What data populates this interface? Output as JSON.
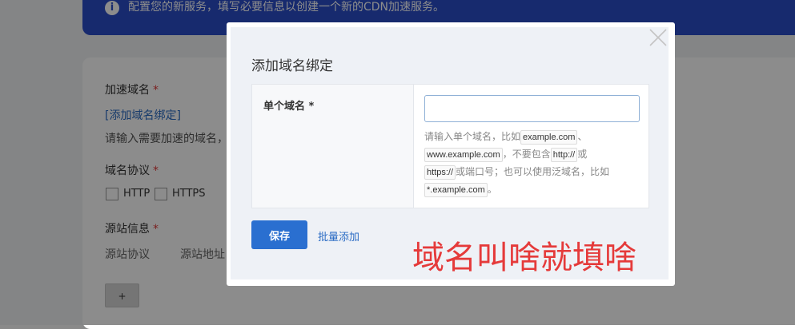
{
  "background": {
    "banner": {
      "icon": "info-icon",
      "text": "配置您的新服务，填写必要信息以创建一个新的CDN加速服务。"
    },
    "form": {
      "accelerated_domain_label": "加速域名",
      "required_mark": "*",
      "add_binding_link": "[添加域名绑定]",
      "domain_hint": "请输入需要加速的域名，",
      "protocol_label": "域名协议",
      "protocol_options": [
        "HTTP",
        "HTTPS"
      ],
      "origin_label": "源站信息",
      "origin_protocol_label": "源站协议",
      "origin_address_label": "源站地址",
      "add_button": "+"
    }
  },
  "modal": {
    "title": "添加域名绑定",
    "close_icon": "close-icon",
    "field_label": "单个域名 *",
    "input_value": "",
    "input_placeholder": "",
    "help": {
      "t1": "请输入单个域名，比如",
      "c1": "example.com",
      "t2": "、",
      "c2": "www.example.com",
      "t3": "，不要包含",
      "c3": "http://",
      "t4": "或",
      "c4": "https://",
      "t5": "或端口号；也可以使用泛域名，比如",
      "c5": "*.example.com",
      "t6": "。"
    },
    "save_button": "保存",
    "bulk_add_link": "批量添加"
  },
  "annotation": {
    "text": "域名叫啥就填啥",
    "color": "#e53a3a"
  },
  "colors": {
    "primary": "#2a6fd0",
    "banner": "#2b4ec9",
    "required": "#e03b3b"
  }
}
